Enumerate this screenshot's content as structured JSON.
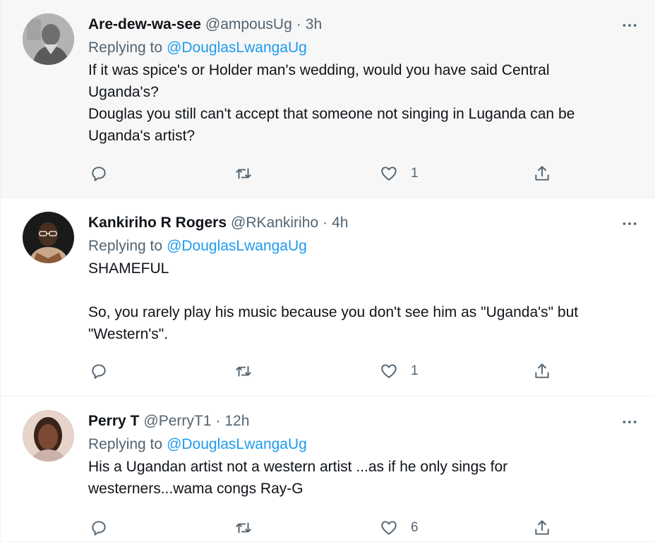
{
  "colors": {
    "link": "#1d9bf0",
    "secondary_text": "#536471",
    "primary_text": "#0f1419",
    "hover_background": "#f7f7f7"
  },
  "tweets": [
    {
      "display_name": "Are-dew-wa-see",
      "handle": "@ampousUg",
      "dot": "·",
      "time": "3h",
      "replying_to_label": "Replying to",
      "replying_to_handle": "@DouglasLwangaUg",
      "text": "If it was spice's or Holder man's wedding, would you have said Central\nUganda's?\nDouglas you still can't accept that someone not singing in Luganda can be\nUganda's artist?",
      "like_count": "1",
      "avatar_icon": "avatar-gray-man-icon"
    },
    {
      "display_name": "Kankiriho R Rogers",
      "handle": "@RKankiriho",
      "dot": "·",
      "time": "4h",
      "replying_to_label": "Replying to",
      "replying_to_handle": "@DouglasLwangaUg",
      "text": "SHAMEFUL\n\nSo, you rarely play his music because you don't see him as \"Uganda's\" but\n\"Western's\".",
      "like_count": "1",
      "avatar_icon": "avatar-man-glasses-icon"
    },
    {
      "display_name": "Perry T",
      "handle": "@PerryT1",
      "dot": "·",
      "time": "12h",
      "replying_to_label": "Replying to",
      "replying_to_handle": "@DouglasLwangaUg",
      "text": "His a Ugandan artist not a western artist ...as if he only sings for\nwesterners...wama congs Ray-G",
      "like_count": "6",
      "avatar_icon": "avatar-woman-icon"
    }
  ]
}
